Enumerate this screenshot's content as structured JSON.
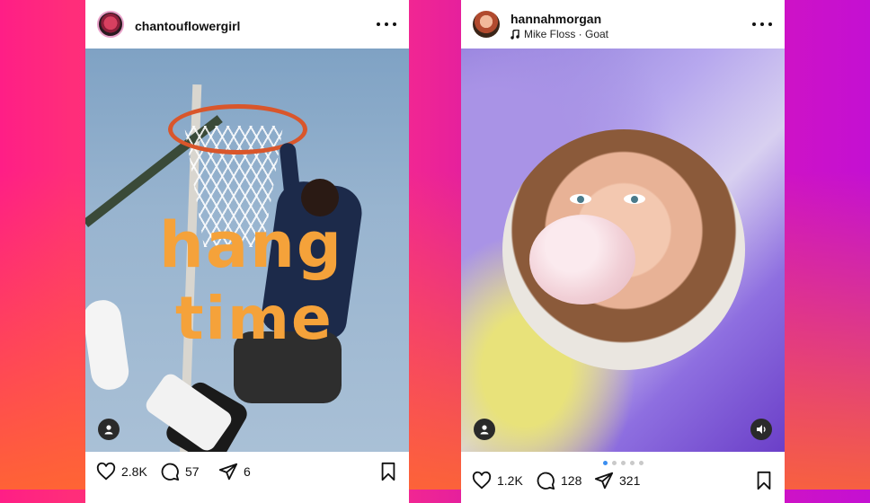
{
  "posts": [
    {
      "username": "chantouflowergirl",
      "overlay_text": [
        "hang",
        "time"
      ],
      "likes": "2.8K",
      "comments": "57",
      "shares": "6"
    },
    {
      "username": "hannahmorgan",
      "music": "Mike Floss · Goat",
      "likes": "1.2K",
      "comments": "128",
      "shares": "321",
      "carousel": {
        "count": 5,
        "active": 0
      }
    }
  ],
  "icons": {
    "more": "more-horizontal-icon",
    "like": "heart-icon",
    "comment": "comment-icon",
    "share": "send-icon",
    "save": "bookmark-icon",
    "user_tag": "person-icon",
    "audio": "speaker-icon",
    "music": "music-note-icon"
  },
  "colors": {
    "overlay_text": "#f5a23a",
    "carousel_active": "#3b8ef0",
    "background_left": "#ff1e86",
    "background_right": "#c410d2"
  }
}
